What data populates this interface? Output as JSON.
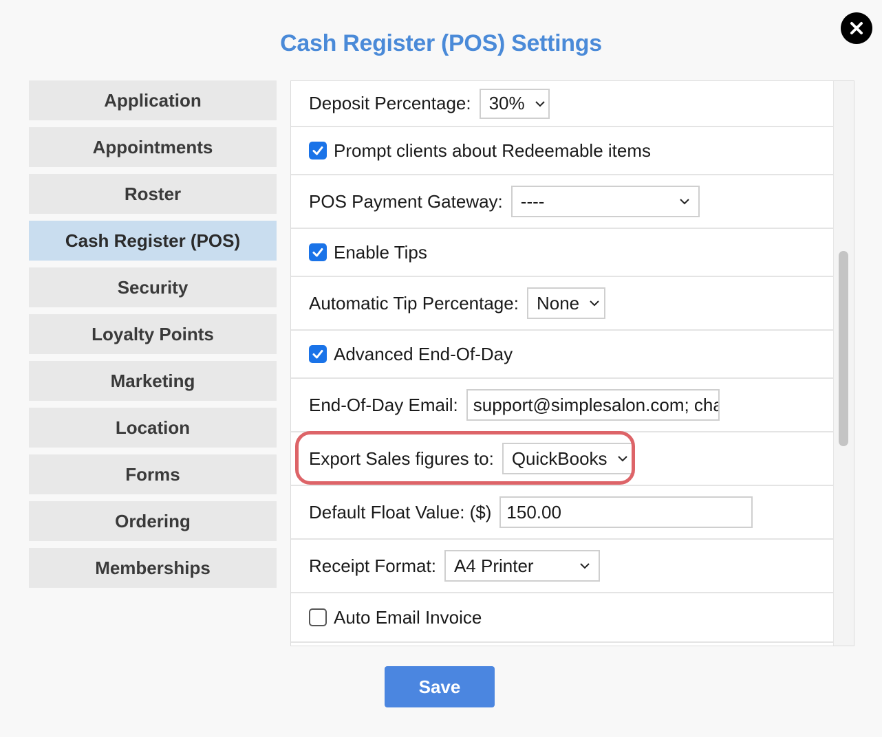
{
  "dialog": {
    "title": "Cash Register (POS) Settings",
    "save_label": "Save"
  },
  "sidebar": {
    "items": [
      {
        "label": "Application",
        "active": false
      },
      {
        "label": "Appointments",
        "active": false
      },
      {
        "label": "Roster",
        "active": false
      },
      {
        "label": "Cash Register (POS)",
        "active": true
      },
      {
        "label": "Security",
        "active": false
      },
      {
        "label": "Loyalty Points",
        "active": false
      },
      {
        "label": "Marketing",
        "active": false
      },
      {
        "label": "Location",
        "active": false
      },
      {
        "label": "Forms",
        "active": false
      },
      {
        "label": "Ordering",
        "active": false
      },
      {
        "label": "Memberships",
        "active": false
      }
    ]
  },
  "settings": {
    "deposit_percentage": {
      "label": "Deposit Percentage:",
      "value": "30%"
    },
    "prompt_redeemable": {
      "label": "Prompt clients about Redeemable items",
      "checked": true
    },
    "payment_gateway": {
      "label": "POS Payment Gateway:",
      "value": "----"
    },
    "enable_tips": {
      "label": "Enable Tips",
      "checked": true
    },
    "auto_tip": {
      "label": "Automatic Tip Percentage:",
      "value": "None"
    },
    "advanced_eod": {
      "label": "Advanced End-Of-Day",
      "checked": true
    },
    "eod_email": {
      "label": "End-Of-Day Email:",
      "value": "support@simplesalon.com; char"
    },
    "export_sales": {
      "label": "Export Sales figures to:",
      "value": "QuickBooks"
    },
    "default_float": {
      "label": "Default Float Value: ($)",
      "value": "150.00"
    },
    "receipt_format": {
      "label": "Receipt Format:",
      "value": "A4 Printer"
    },
    "auto_email_invoice": {
      "label": "Auto Email Invoice",
      "checked": false
    }
  },
  "colors": {
    "title": "#4a8ad8",
    "checkbox": "#1a73e8",
    "highlight": "#dd6468",
    "save_button": "#4b86e0",
    "active_tab": "#c9ddef"
  },
  "icons": {
    "close": "close-icon",
    "select": "chevron-down-icon",
    "checked": "checkmark-icon"
  }
}
